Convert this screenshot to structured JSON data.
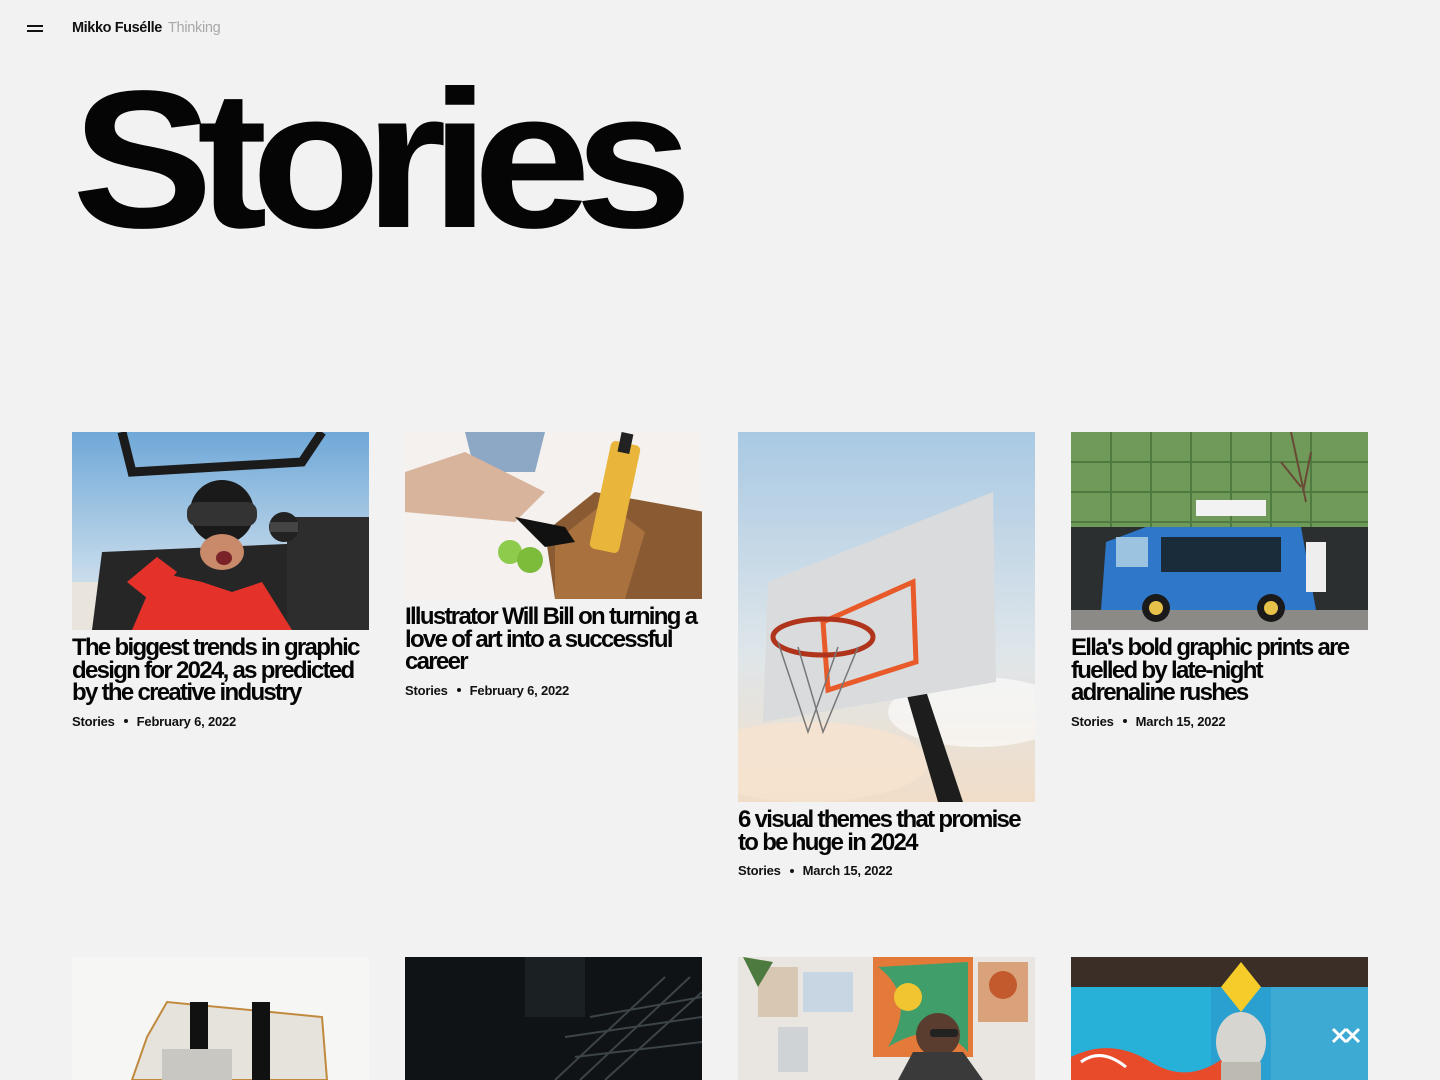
{
  "header": {
    "brand": "Mikko Fuséllе",
    "section": "Thinking"
  },
  "page": {
    "title": "Stories"
  },
  "cards": [
    {
      "title": "The biggest trends in graphic design for 2024, as predicted by the creative industry",
      "category": "Stories",
      "date": "February 6, 2022"
    },
    {
      "title": "Illustrator Will Bill on turning a love of art into a successful career",
      "category": "Stories",
      "date": "February 6, 2022"
    },
    {
      "title": "6 visual themes that promise to be huge in 2024",
      "category": "Stories",
      "date": "March 15, 2022"
    },
    {
      "title": "Ella's bold graphic prints are fuelled by late-night adrenaline rushes",
      "category": "Stories",
      "date": "March 15, 2022"
    }
  ],
  "icons": {
    "menu": "hamburger-icon"
  },
  "colors": {
    "background": "#f2f2f2",
    "text": "#0a0a0a",
    "muted": "#a8a8a8"
  }
}
